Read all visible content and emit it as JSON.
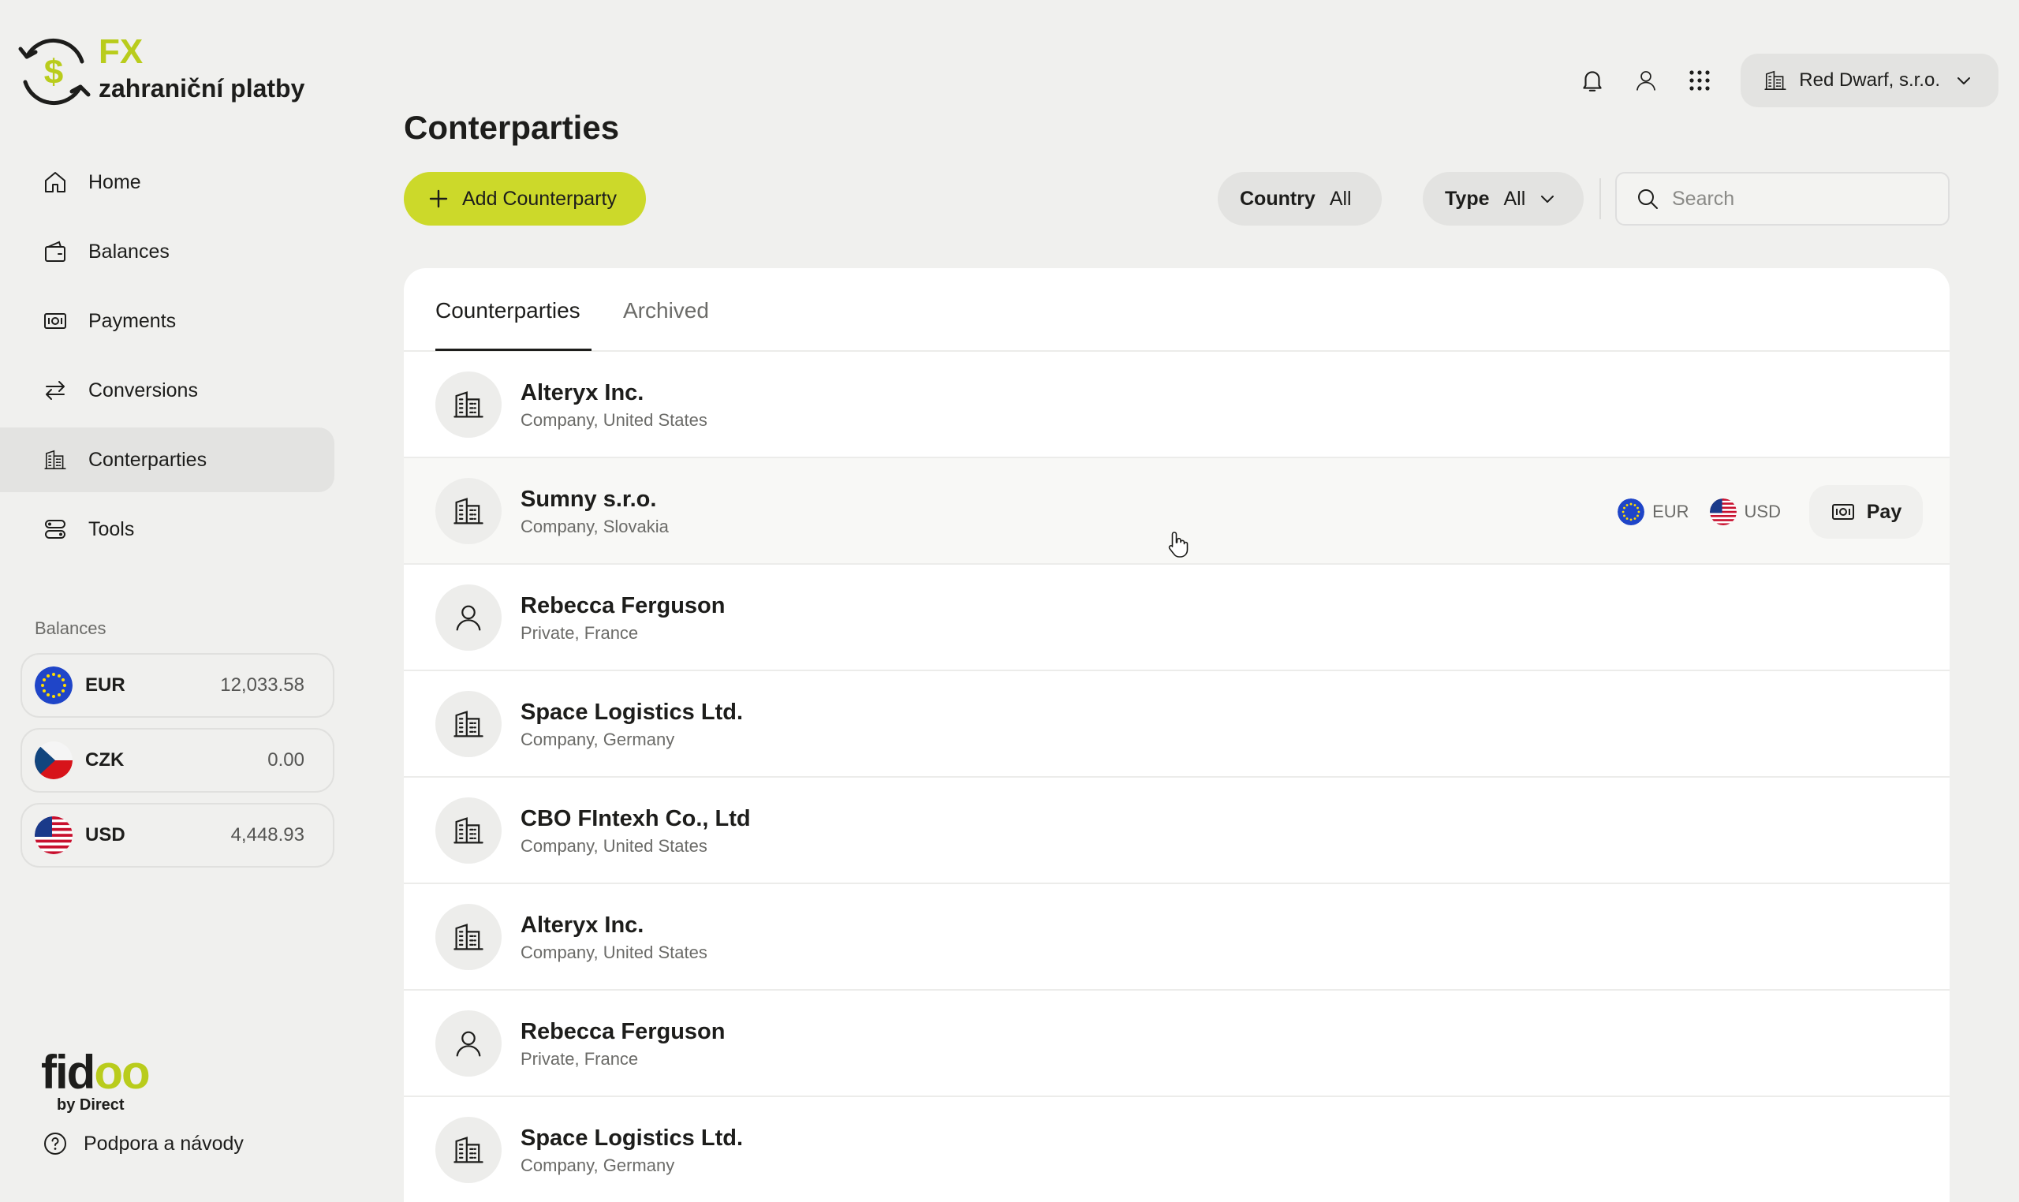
{
  "brand": {
    "fx": "FX",
    "subtitle": "zahraniční platby"
  },
  "nav": {
    "home": "Home",
    "balances": "Balances",
    "payments": "Payments",
    "conversions": "Conversions",
    "counterparties": "Conterparties",
    "tools": "Tools"
  },
  "balances": {
    "heading": "Balances",
    "items": [
      {
        "code": "EUR",
        "amount": "12,033.58"
      },
      {
        "code": "CZK",
        "amount": "0.00"
      },
      {
        "code": "USD",
        "amount": "4,448.93"
      }
    ]
  },
  "footer": {
    "brand_main": "fid",
    "brand_accent": "oo",
    "brand_by": "by Direct",
    "support": "Podpora a návody"
  },
  "topbar": {
    "org_name": "Red Dwarf, s.r.o."
  },
  "page": {
    "title": "Conterparties",
    "add_button": "Add Counterparty",
    "filters": {
      "country_label": "Country",
      "country_value": "All",
      "type_label": "Type",
      "type_value": "All"
    },
    "search_placeholder": "Search"
  },
  "tabs": {
    "counterparties": "Counterparties",
    "archived": "Archived"
  },
  "rows": [
    {
      "name": "Alteryx Inc.",
      "sub": "Company, United States",
      "kind": "company"
    },
    {
      "name": "Sumny s.r.o.",
      "sub": "Company, Slovakia",
      "kind": "company",
      "currencies": [
        "EUR",
        "USD"
      ],
      "action": "Pay"
    },
    {
      "name": "Rebecca Ferguson",
      "sub": "Private, France",
      "kind": "private"
    },
    {
      "name": "Space Logistics Ltd.",
      "sub": "Company, Germany",
      "kind": "company"
    },
    {
      "name": "CBO FIntexh Co., Ltd",
      "sub": "Company, United States",
      "kind": "company"
    },
    {
      "name": "Alteryx Inc.",
      "sub": "Company, United States",
      "kind": "company"
    },
    {
      "name": "Rebecca Ferguson",
      "sub": "Private, France",
      "kind": "private"
    },
    {
      "name": "Space Logistics Ltd.",
      "sub": "Company, Germany",
      "kind": "company"
    }
  ],
  "colors": {
    "accent": "#ccd92a",
    "brand_green": "#b9cc1c",
    "background": "#f0f0ee"
  }
}
